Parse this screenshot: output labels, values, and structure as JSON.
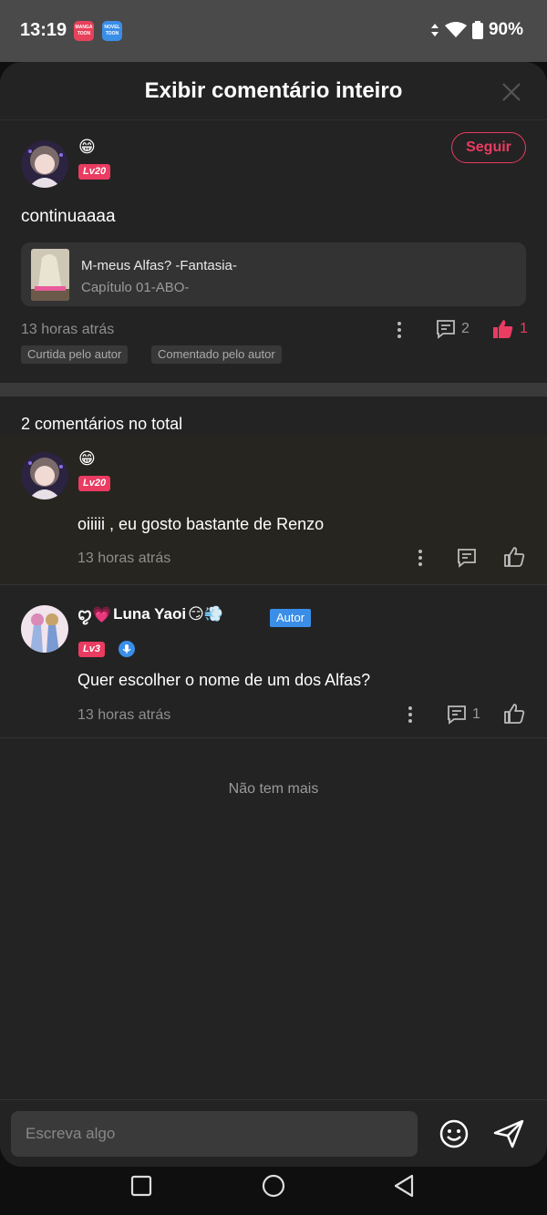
{
  "status_bar": {
    "time": "13:19",
    "apps": [
      {
        "label": "MANGA TOON"
      },
      {
        "label": "NOVEL TOON"
      }
    ],
    "battery": "90%"
  },
  "sheet": {
    "title": "Exibir comentário inteiro",
    "close_icon": "close-icon"
  },
  "main_comment": {
    "emoji": "😁",
    "level": "Lv20",
    "follow_label": "Seguir",
    "text": "continuaaaa",
    "work": {
      "title": "M-meus Alfas? -Fantasia-",
      "chapter": "Capítulo 01-ABO-"
    },
    "time": "13 horas atrás",
    "comment_count": "2",
    "like_count": "1",
    "tags": [
      "Curtida pelo autor",
      "Comentado pelo autor"
    ]
  },
  "total_label": "2 comentários no total",
  "replies": [
    {
      "emoji": "😁",
      "level": "Lv20",
      "text": "oiiiii , eu gosto bastante de Renzo",
      "time": "13 horas atrás"
    },
    {
      "name": "Luna Yaoi",
      "name_prefix": "ꨄ💗",
      "name_suffix": "😏💨",
      "badge": "Autor",
      "level": "Lv3",
      "text": "Quer escolher o nome de um dos Alfas?",
      "time": "13 horas atrás",
      "comment_count": "1"
    }
  ],
  "no_more_label": "Não tem mais",
  "input": {
    "placeholder": "Escreva algo"
  },
  "colors": {
    "accent": "#ea3b61",
    "author_badge": "#3a8ee8",
    "sheet_bg": "#232323"
  }
}
